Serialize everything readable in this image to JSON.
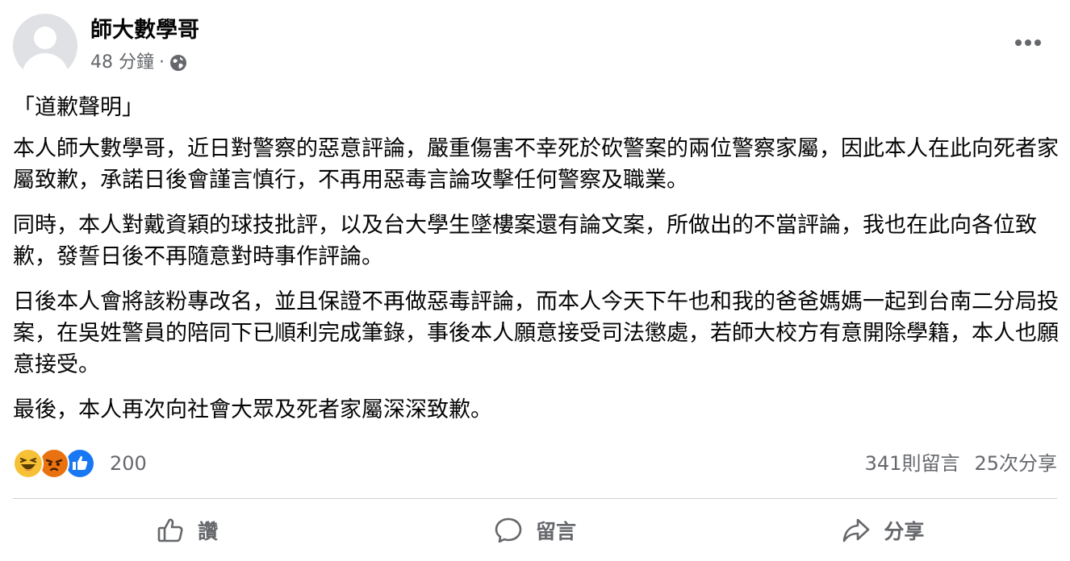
{
  "post": {
    "author": "師大數學哥",
    "time": "48 分鐘",
    "separator": "·",
    "privacy_icon": "globe-icon",
    "title": "「道歉聲明」",
    "paragraphs": [
      "本人師大數學哥，近日對警察的惡意評論，嚴重傷害不幸死於砍警案的兩位警察家屬，因此本人在此向死者家屬致歉，承諾日後會謹言慎行，不再用惡毒言論攻擊任何警察及職業。",
      "同時，本人對戴資穎的球技批評，以及台大學生墜樓案還有論文案，所做出的不當評論，我也在此向各位致歉，發誓日後不再隨意對時事作評論。",
      "日後本人會將該粉專改名，並且保證不再做惡毒評論，而本人今天下午也和我的爸爸媽媽一起到台南二分局投案，在吳姓警員的陪同下已順利完成筆錄，事後本人願意接受司法懲處，若師大校方有意開除學籍，本人也願意接受。",
      "最後，本人再次向社會大眾及死者家屬深深致歉。"
    ]
  },
  "reactions": {
    "icons": [
      "haha-icon",
      "angry-icon",
      "like-icon"
    ],
    "count": "200"
  },
  "stats": {
    "comments": "341則留言",
    "shares": "25次分享"
  },
  "actions": {
    "like_label": "讚",
    "comment_label": "留言",
    "share_label": "分享"
  },
  "colors": {
    "text": "#050505",
    "secondary": "#65676b",
    "like_blue": "#1877f2",
    "haha_yellow": "#f7c137",
    "angry_orange": "#e9710f",
    "divider": "#ced0d4"
  }
}
